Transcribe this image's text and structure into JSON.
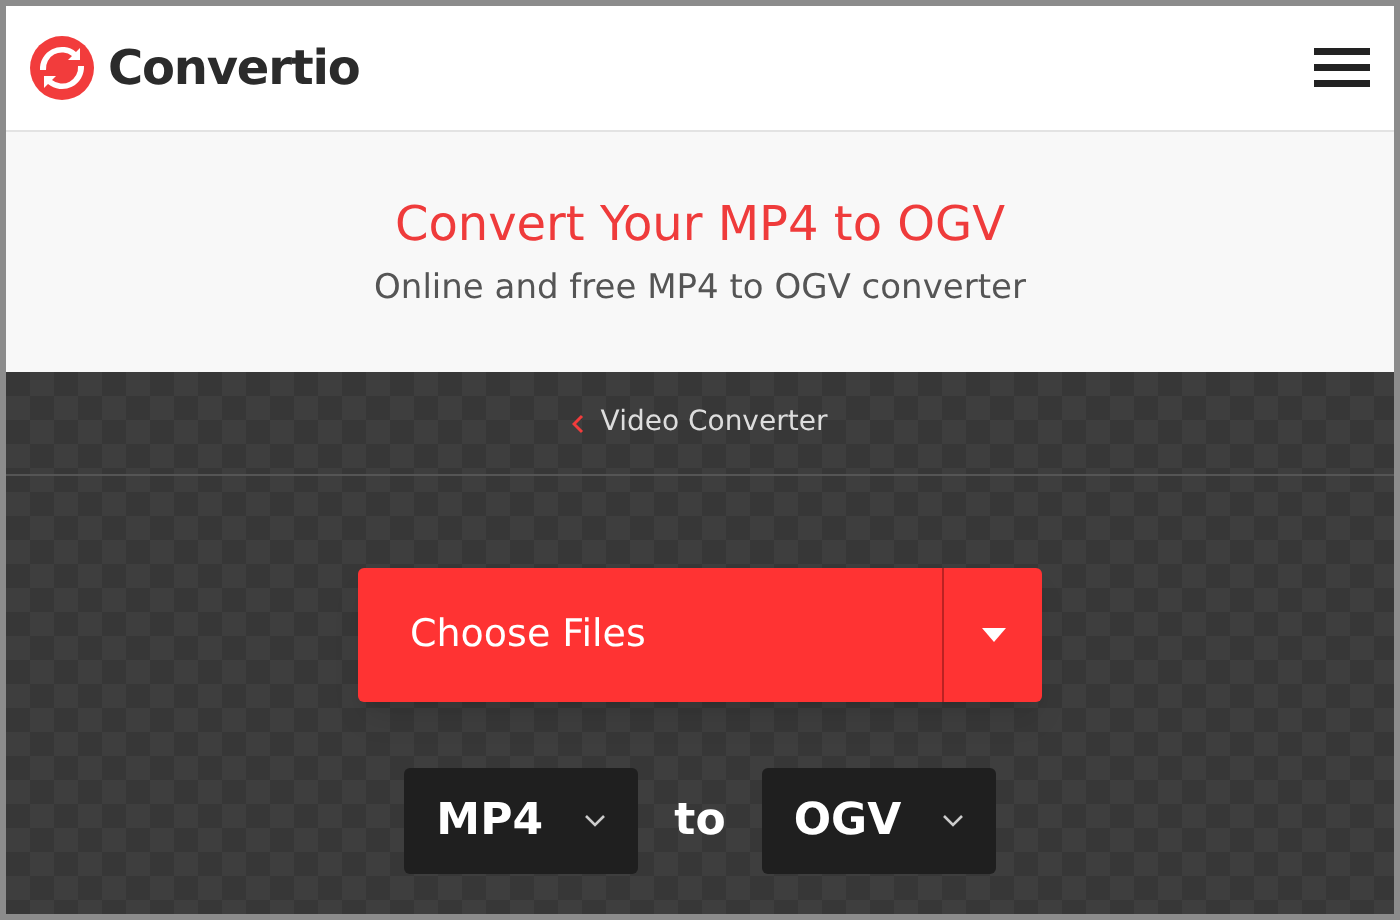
{
  "header": {
    "logo_text": "Convertio"
  },
  "hero": {
    "title": "Convert Your MP4 to OGV",
    "subtitle": "Online and free MP4 to OGV converter"
  },
  "breadcrumb": {
    "label": "Video Converter"
  },
  "upload": {
    "button": "Choose Files"
  },
  "conversion": {
    "from": "MP4",
    "separator": "to",
    "to": "OGV"
  }
}
